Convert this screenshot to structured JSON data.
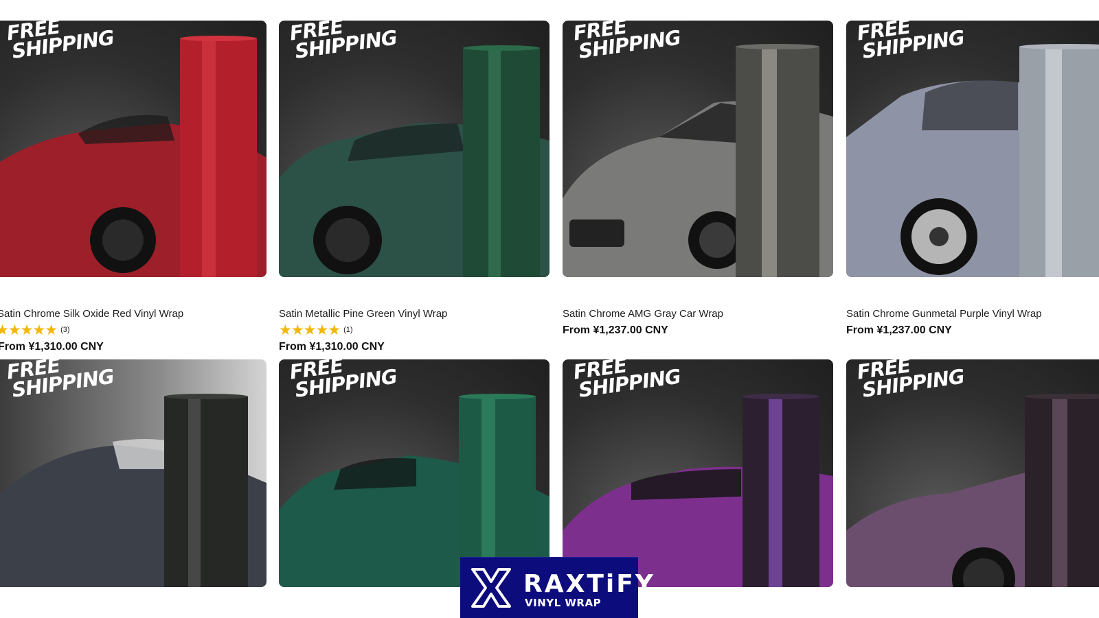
{
  "badge": {
    "line1": "FREE",
    "line2": "SHIPPING"
  },
  "products": [
    {
      "title": "Satin Chrome Silk Oxide Red Vinyl Wrap",
      "stars": "★★★★★",
      "rating_count": "(3)",
      "price": "From ¥1,310.00 CNY",
      "rating_value": 5,
      "car_color": "#9c1f2a",
      "roll_color": "#b3202c"
    },
    {
      "title": "Satin Metallic Pine Green Vinyl Wrap",
      "stars": "★★★★★",
      "rating_count": "(1)",
      "price": "From ¥1,310.00 CNY",
      "rating_value": 5,
      "car_color": "#2c5147",
      "roll_color": "#1f4a36"
    },
    {
      "title": "Satin Chrome AMG Gray Car Wrap",
      "price": "From ¥1,237.00 CNY",
      "car_color": "#7a7a78",
      "roll_color": "#4c4c48"
    },
    {
      "title": "Satin Chrome Gunmetal Purple Vinyl Wrap",
      "price": "From ¥1,237.00 CNY",
      "car_color": "#8f93a6",
      "roll_color": "#9aa0a8"
    },
    {
      "title": "",
      "car_color": "#3c4048",
      "roll_color": "#262826"
    },
    {
      "title": "",
      "car_color": "#1d5a4a",
      "roll_color": "#1c5a45"
    },
    {
      "title": "",
      "car_color": "#7d2f8e",
      "roll_color": "#2c2030"
    },
    {
      "title": "",
      "car_color": "#6b4e6e",
      "roll_color": "#2a2228"
    }
  ],
  "logo": {
    "brand": "RAXTiFY",
    "sub": "VINYL WRAP",
    "bg": "#0c0c7c"
  }
}
